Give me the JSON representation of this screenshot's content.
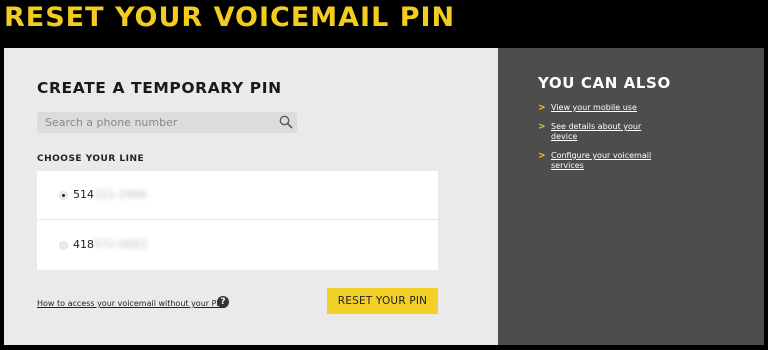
{
  "page": {
    "title": "RESET YOUR VOICEMAIL PIN"
  },
  "form": {
    "title": "CREATE A TEMPORARY PIN",
    "search": {
      "placeholder": "Search a phone number",
      "value": ""
    },
    "choose_line_label": "CHOOSE YOUR LINE",
    "lines": [
      {
        "prefix": "514",
        "rest": "521-2966",
        "selected": true
      },
      {
        "prefix": "418",
        "rest": "572-0693",
        "selected": false
      }
    ],
    "help_link": "How to access your voicemail without your PIN",
    "help_icon": "?",
    "reset_button": "RESET YOUR PIN"
  },
  "sidebar": {
    "title": "YOU CAN ALSO",
    "chevron": ">",
    "links": [
      {
        "label": "View your mobile use"
      },
      {
        "label": "See details about your device"
      },
      {
        "label": "Configure your voicemail services"
      }
    ]
  },
  "colors": {
    "accent": "#f2cd1e",
    "page_background": "#000000",
    "form_background": "#eaeaea",
    "sidebar_background": "#4d4d4d"
  },
  "icons": {
    "search": "search-icon",
    "help": "question-icon",
    "chevron": "chevron-right-icon"
  }
}
